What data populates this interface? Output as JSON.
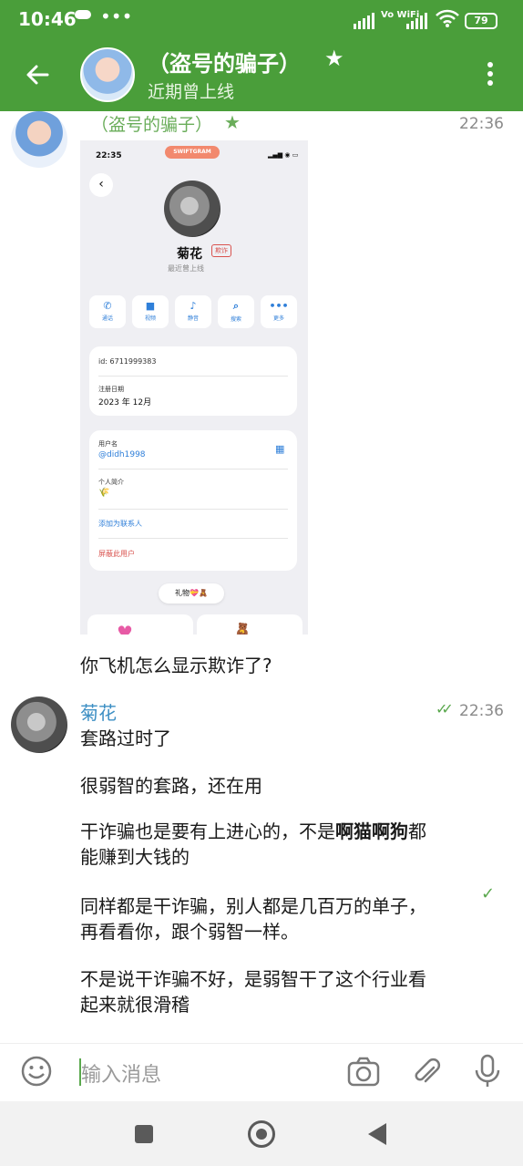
{
  "status": {
    "time": "10:46",
    "more": "•••",
    "vowifi": "Vo WiFi",
    "battery": "79"
  },
  "header": {
    "title": "（盗号的骗子）",
    "subtitle": "近期曾上线"
  },
  "message1": {
    "sender": "（盗号的骗子）",
    "time": "22:36",
    "screenshot": {
      "time": "22:35",
      "app_badge": "SWIFTGRAM",
      "name": "菊花",
      "badge": "欺诈",
      "last_seen": "最近曾上线",
      "actions": [
        {
          "icon": "phone-icon",
          "label": "通话"
        },
        {
          "icon": "video-icon",
          "label": "视频"
        },
        {
          "icon": "bell-icon",
          "label": "静音"
        },
        {
          "icon": "search-icon",
          "label": "搜索"
        },
        {
          "icon": "more-icon",
          "label": "更多"
        }
      ],
      "id_line": "id: 6711999383",
      "reg_label": "注册日期",
      "reg_value": "2023 年 12月",
      "username_label": "用户名",
      "username_value": "@didh1998",
      "bio_label": "个人简介",
      "add_contact": "添加为联系人",
      "block_user": "屏蔽此用户",
      "gift": "礼物💝🧸"
    },
    "caption": "你飞机怎么显示欺诈了?"
  },
  "message2": {
    "sender": "菊花",
    "time": "22:36",
    "lines": [
      {
        "text": "套路过时了"
      },
      {
        "text": "很弱智的套路，还在用"
      },
      {
        "pre": "干诈骗也是要有上进心的，不是",
        "bold": "啊猫啊狗",
        "post": "都",
        "line2": "能赚到大钱的"
      },
      {
        "text": "同样都是干诈骗，别人都是几百万的单子，",
        "line2": "再看看你，跟个弱智一样。"
      },
      {
        "text": "不是说干诈骗不好，是弱智干了这个行业看",
        "line2": "起来就很滑稽"
      }
    ]
  },
  "input": {
    "placeholder": "输入消息"
  },
  "colors": {
    "brand_green": "#4a9e3a",
    "name_blue": "#3d8fc4"
  }
}
